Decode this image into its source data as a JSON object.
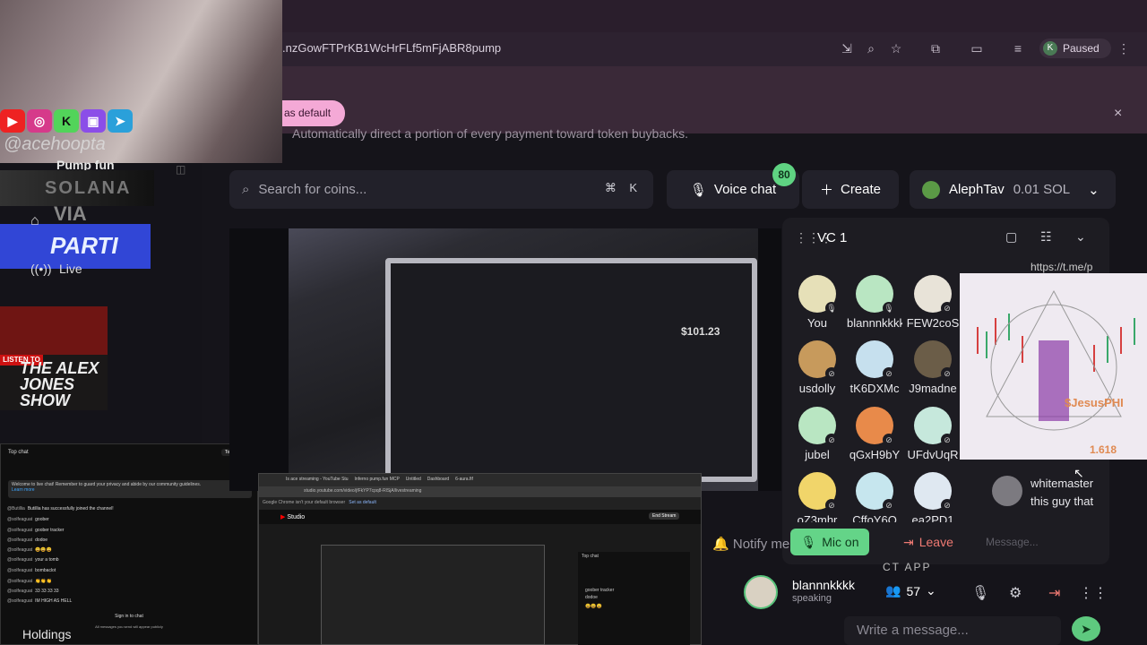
{
  "browser": {
    "url": ".nzGowFTPrKB1WcHrFLf5mFjABR8pump",
    "profile_initial": "K",
    "profile_status": "Paused",
    "default_button": "as default",
    "infobar_text": "Automatically direct a portion of every payment toward token buybacks.",
    "close": "×"
  },
  "webcam": {
    "handle": "@acehoopta"
  },
  "sidebar": {
    "brand": "Pump fun",
    "solana": "SOLANA",
    "parti": "PARTI",
    "via": "VIA",
    "live": "Live",
    "listen": "LISTEN TO",
    "alex_jones": "THE ALEX JONES SHOW",
    "holdings": "Holdings"
  },
  "ytchat": {
    "header": "Top chat",
    "top_fans": "Top fans",
    "welcome": "Welcome to live chat! Remember to guard your privacy and abide by our community guidelines.",
    "learn_more": "Learn more",
    "messages": [
      {
        "user": "@Butillia",
        "text": "Butillia has successfully joined the channel!"
      },
      {
        "user": "@solfeaguat",
        "text": "goober"
      },
      {
        "user": "@solfeaguat",
        "text": "goober tracker"
      },
      {
        "user": "@solfeaguat",
        "text": "dodoe"
      },
      {
        "user": "@solfeaguat",
        "text": "😀😀😀"
      },
      {
        "user": "@solfeaguat",
        "text": "your a tomb"
      },
      {
        "user": "@solfeaguat",
        "text": "bombaclot"
      },
      {
        "user": "@solfeaguat",
        "text": "👏👏👏"
      },
      {
        "user": "@solfeaguat",
        "text": "33 33 33 33"
      },
      {
        "user": "@solfeaguat",
        "text": "IM HIGH AS HELL"
      }
    ],
    "sign_in": "Sign in to chat",
    "all_messages": "All messages you send will appear publicly"
  },
  "header": {
    "search_placeholder": "Search for coins...",
    "kbd_cmd": "⌘",
    "kbd_k": "K",
    "voice_chat": "Voice chat",
    "voice_count": "80",
    "create": "Create",
    "wallet_name": "AlephTav",
    "wallet_balance": "0.01 SOL"
  },
  "stage": {
    "laptop_price": "$101.23"
  },
  "studio": {
    "tab1": "Is ace streaming - YouTube Stu",
    "tab2": "Inferno­ pump.fun MCP",
    "tab3": "Untitled",
    "tab4": "Dashboard",
    "tab5": "6-aura.fif",
    "addr": "studio.youtube.com/video/jfFkYP7cpq8-RlSjA/livestreaming",
    "banner": "Google Chrome isn't your default browser",
    "banner_btn": "Set as default",
    "studio_label": "Studio",
    "end_stream": "End Stream",
    "chat_header": "Top chat",
    "chat_lines": [
      "goober tracker",
      "dodoe",
      "😀😀😀"
    ]
  },
  "vc": {
    "title": "VC 1",
    "participants": [
      {
        "name": "You",
        "color": "#e6e0b8"
      },
      {
        "name": "blannnkkkk",
        "color": "#b9e6c2"
      },
      {
        "name": "FEW2coS",
        "color": "#e8e3d8"
      },
      {
        "name": "usdolly",
        "color": "#c79a5c"
      },
      {
        "name": "tK6DXMc",
        "color": "#c6e0ee"
      },
      {
        "name": "J9madne",
        "color": "#6b5d48"
      },
      {
        "name": "jubel",
        "color": "#b9e6c2"
      },
      {
        "name": "qGxH9bY",
        "color": "#e88a4a"
      },
      {
        "name": "UFdvUqR",
        "color": "#c6e8dc"
      },
      {
        "name": "oZ3mhr",
        "color": "#f1d56a"
      },
      {
        "name": "CffoY6Q",
        "color": "#c6e6ee"
      },
      {
        "name": "ea2PD1",
        "color": "#dfe8f1"
      }
    ],
    "mic_on": "Mic on",
    "leave": "Leave",
    "notify": "Notify me",
    "link": "https://t.me/p",
    "chart_name": "$JesusPHI",
    "chart_value": "1.618",
    "msg_author": "whitemaster",
    "msg_body": "this guy that",
    "msg_placeholder": "Message...",
    "ct_app": "CT APP"
  },
  "speaker": {
    "name": "blannnkkkk",
    "status": "speaking",
    "listeners": "57",
    "write_placeholder": "Write a message..."
  },
  "colors": {
    "accent_green": "#5ec97f",
    "leave_red": "#f07a73",
    "infobar_pink": "#f4a9d6"
  }
}
